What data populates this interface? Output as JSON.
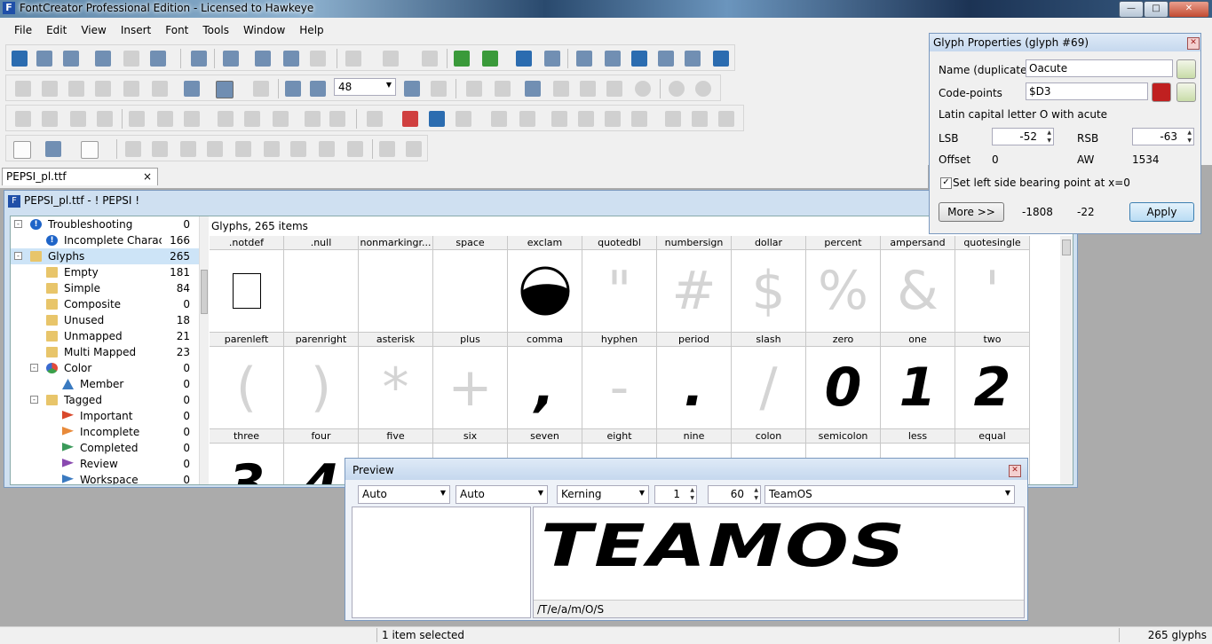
{
  "window": {
    "title": "FontCreator Professional Edition - Licensed to Hawkeye",
    "icon": "fontcreator-app-icon",
    "controls": [
      "minimize",
      "maximize",
      "close"
    ]
  },
  "menu": [
    "File",
    "Edit",
    "View",
    "Insert",
    "Font",
    "Tools",
    "Window",
    "Help"
  ],
  "toolbar": {
    "zoom_value": "48"
  },
  "document_tab": {
    "label": "PEPSI_pl.ttf",
    "close": "×"
  },
  "mdi": {
    "title": "PEPSI_pl.ttf - ! PEPSI !"
  },
  "tree": [
    {
      "label": "Troubleshooting",
      "count": "0",
      "icon": "info-icon",
      "indent": 0,
      "expand": "-"
    },
    {
      "label": "Incomplete Charac...",
      "count": "166",
      "icon": "info-icon",
      "indent": 1
    },
    {
      "label": "Glyphs",
      "count": "265",
      "icon": "folder-icon",
      "indent": 0,
      "expand": "-",
      "selected": true
    },
    {
      "label": "Empty",
      "count": "181",
      "icon": "folder-icon",
      "indent": 1
    },
    {
      "label": "Simple",
      "count": "84",
      "icon": "folder-icon",
      "indent": 1
    },
    {
      "label": "Composite",
      "count": "0",
      "icon": "folder-icon",
      "indent": 1
    },
    {
      "label": "Unused",
      "count": "18",
      "icon": "folder-icon",
      "indent": 1
    },
    {
      "label": "Unmapped",
      "count": "21",
      "icon": "folder-icon",
      "indent": 1
    },
    {
      "label": "Multi Mapped",
      "count": "23",
      "icon": "folder-icon",
      "indent": 1
    },
    {
      "label": "Color",
      "count": "0",
      "icon": "color-pie-icon",
      "indent": 1,
      "expand": "-"
    },
    {
      "label": "Member",
      "count": "0",
      "icon": "triangle-icon",
      "indent": 2
    },
    {
      "label": "Tagged",
      "count": "0",
      "icon": "folder-icon",
      "indent": 1,
      "expand": "-"
    },
    {
      "label": "Important",
      "count": "0",
      "icon": "flag-red-icon",
      "indent": 2
    },
    {
      "label": "Incomplete",
      "count": "0",
      "icon": "flag-orange-icon",
      "indent": 2
    },
    {
      "label": "Completed",
      "count": "0",
      "icon": "flag-green-icon",
      "indent": 2
    },
    {
      "label": "Review",
      "count": "0",
      "icon": "flag-purple-icon",
      "indent": 2
    },
    {
      "label": "Workspace",
      "count": "0",
      "icon": "flag-blue-icon",
      "indent": 2
    }
  ],
  "glyphs": {
    "header": "Glyphs, 265 items",
    "cells": [
      {
        "name": ".notdef",
        "glyph": "",
        "kind": "notdef"
      },
      {
        "name": ".null",
        "glyph": "",
        "kind": "empty"
      },
      {
        "name": "nonmarkingr...",
        "glyph": "",
        "kind": "empty"
      },
      {
        "name": "space",
        "glyph": "",
        "kind": "empty"
      },
      {
        "name": "exclam",
        "glyph": "",
        "kind": "pepsi-logo"
      },
      {
        "name": "quotedbl",
        "glyph": "\"",
        "kind": "ghost"
      },
      {
        "name": "numbersign",
        "glyph": "#",
        "kind": "ghost"
      },
      {
        "name": "dollar",
        "glyph": "$",
        "kind": "ghost"
      },
      {
        "name": "percent",
        "glyph": "%",
        "kind": "ghost"
      },
      {
        "name": "ampersand",
        "glyph": "&",
        "kind": "ghost"
      },
      {
        "name": "quotesingle",
        "glyph": "'",
        "kind": "ghost"
      },
      {
        "name": "parenleft",
        "glyph": "(",
        "kind": "ghost"
      },
      {
        "name": "parenright",
        "glyph": ")",
        "kind": "ghost"
      },
      {
        "name": "asterisk",
        "glyph": "*",
        "kind": "ghost"
      },
      {
        "name": "plus",
        "glyph": "+",
        "kind": "ghost"
      },
      {
        "name": "comma",
        "glyph": ",",
        "kind": "black"
      },
      {
        "name": "hyphen",
        "glyph": "-",
        "kind": "ghost"
      },
      {
        "name": "period",
        "glyph": ".",
        "kind": "black"
      },
      {
        "name": "slash",
        "glyph": "/",
        "kind": "ghost"
      },
      {
        "name": "zero",
        "glyph": "0",
        "kind": "black"
      },
      {
        "name": "one",
        "glyph": "1",
        "kind": "black"
      },
      {
        "name": "two",
        "glyph": "2",
        "kind": "black"
      },
      {
        "name": "three",
        "glyph": "3",
        "kind": "black"
      },
      {
        "name": "four",
        "glyph": "4",
        "kind": "black"
      },
      {
        "name": "five",
        "glyph": "",
        "kind": "empty"
      },
      {
        "name": "six",
        "glyph": "",
        "kind": "empty"
      },
      {
        "name": "seven",
        "glyph": "",
        "kind": "empty"
      },
      {
        "name": "eight",
        "glyph": "",
        "kind": "empty"
      },
      {
        "name": "nine",
        "glyph": "",
        "kind": "empty"
      },
      {
        "name": "colon",
        "glyph": "",
        "kind": "empty"
      },
      {
        "name": "semicolon",
        "glyph": "",
        "kind": "empty"
      },
      {
        "name": "less",
        "glyph": "",
        "kind": "empty"
      },
      {
        "name": "equal",
        "glyph": "",
        "kind": "empty"
      }
    ]
  },
  "properties": {
    "title": "Glyph Properties (glyph #69)",
    "name_label": "Name (duplicate!)",
    "name_value": "Oacute",
    "codepoints_label": "Code-points",
    "codepoints_value": "$D3",
    "description": "Latin capital letter O with acute",
    "lsb_label": "LSB",
    "lsb_value": "-52",
    "rsb_label": "RSB",
    "rsb_value": "-63",
    "offset_label": "Offset",
    "offset_value": "0",
    "aw_label": "AW",
    "aw_value": "1534",
    "checkbox_label": "Set left side bearing point at x=0",
    "checkbox_checked": true,
    "more_label": "More >>",
    "val1": "-1808",
    "val2": "-22",
    "apply_label": "Apply"
  },
  "preview": {
    "title": "Preview",
    "combo1": "Auto",
    "combo2": "Auto",
    "combo3": "Kerning",
    "spin1": "1",
    "spin2": "60",
    "text_combo": "TeamOS",
    "rendered_text": "TEAMOS",
    "glyph_sequence": "/T/e/a/m/O/S"
  },
  "status": {
    "selection": "1 item selected",
    "glyph_count": "265 glyphs"
  },
  "colors": {
    "selection": "#cde4f7",
    "panel_border": "#7a99bf",
    "apply_button": "#b9dcf4"
  }
}
